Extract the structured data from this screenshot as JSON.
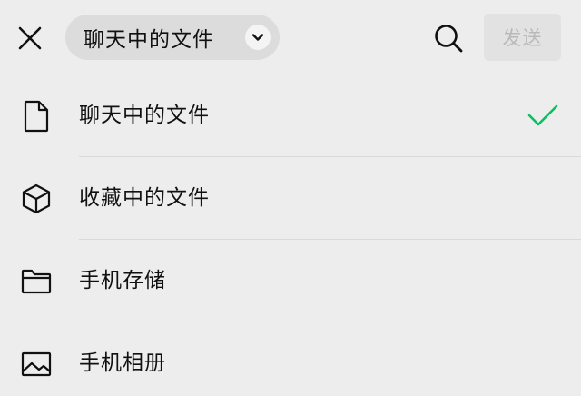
{
  "header": {
    "close_icon": "close-icon",
    "source_selector": {
      "label": "聊天中的文件",
      "icon": "chevron-down-icon"
    },
    "search_icon": "search-icon",
    "send_label": "发送"
  },
  "colors": {
    "background": "#ededed",
    "pill": "#dcdcdc",
    "send_disabled_bg": "#e2e2e2",
    "send_disabled_text": "#b9b9b9",
    "check": "#07c160"
  },
  "list": {
    "items": [
      {
        "label": "聊天中的文件",
        "icon": "file-icon",
        "selected": true
      },
      {
        "label": "收藏中的文件",
        "icon": "cube-icon",
        "selected": false
      },
      {
        "label": "手机存储",
        "icon": "folder-icon",
        "selected": false
      },
      {
        "label": "手机相册",
        "icon": "image-icon",
        "selected": false
      }
    ]
  }
}
